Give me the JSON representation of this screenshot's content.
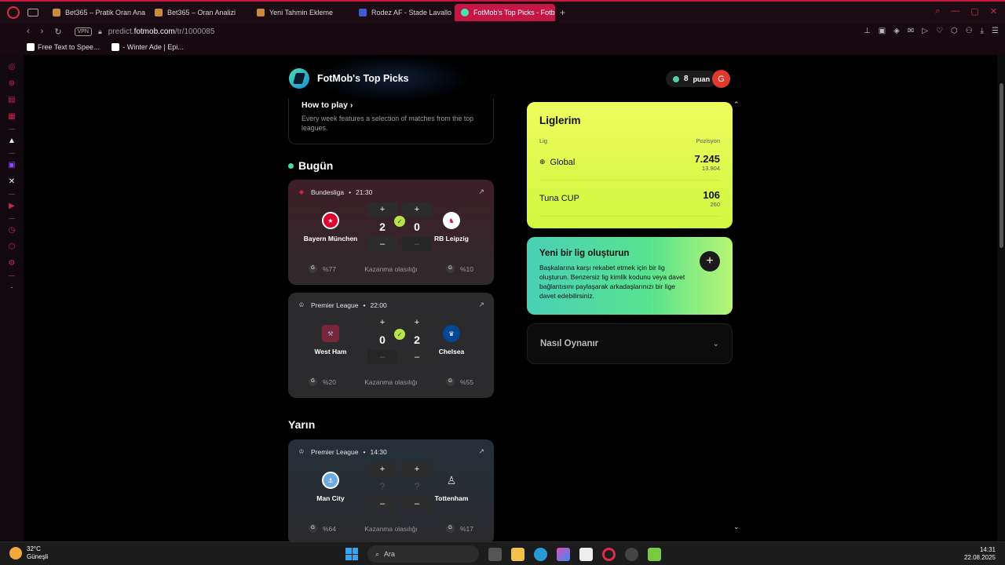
{
  "browser": {
    "tabs": [
      {
        "title": "Bet365 – Pratik Oran Ana",
        "color": "#c98b3a",
        "active": false
      },
      {
        "title": "Bet365 – Oran Analizi",
        "color": "#c98b3a",
        "active": false
      },
      {
        "title": "Yeni Tahmin Ekleme",
        "color": "#c98b3a",
        "active": false
      },
      {
        "title": "Rodez AF - Stade Lavallo",
        "color": "#3b5bd6",
        "active": false
      },
      {
        "title": "FotMob's Top Picks - Fotb",
        "color": "#49e0b4",
        "active": true
      }
    ],
    "new_tab": "+",
    "vpn": "VPN",
    "url_prefix": "predict.",
    "url_domain": "fotmob.com",
    "url_path": "/tr/1000085",
    "bookmarks": [
      "Free Text to Spee...",
      "- Winter Ade | Epi..."
    ]
  },
  "header": {
    "title": "FotMob's Top Picks",
    "points_value": "8",
    "points_unit": "puan",
    "avatar_letter": "G"
  },
  "howto": {
    "title": "How to play",
    "chevron": "›",
    "text": "Every week features a selection of matches from the top leagues."
  },
  "sections": {
    "today": "Bugün",
    "tomorrow": "Yarın"
  },
  "matches": [
    {
      "league": "Bundesliga",
      "time": "21:30",
      "home": "Bayern München",
      "away": "RB Leipzig",
      "home_score": "2",
      "away_score": "0",
      "home_pct": "%77",
      "away_pct": "%10",
      "win_label": "Kazanma olasılığı",
      "bg": "#3a1f26"
    },
    {
      "league": "Premier League",
      "time": "22:00",
      "home": "West Ham",
      "away": "Chelsea",
      "home_score": "0",
      "away_score": "2",
      "home_pct": "%20",
      "away_pct": "%55",
      "win_label": "Kazanma olasılığı",
      "bg": "#2a2b2e"
    },
    {
      "league": "Premier League",
      "time": "14:30",
      "home": "Man City",
      "away": "Tottenham",
      "home_score": "?",
      "away_score": "?",
      "home_pct": "%64",
      "away_pct": "%17",
      "win_label": "Kazanma olasılığı",
      "bg": "#23282e"
    }
  ],
  "leagues": {
    "title": "Liglerim",
    "col_league": "Lig",
    "col_position": "Pozisyon",
    "rows": [
      {
        "name": "Global",
        "position": "7.245",
        "total": "13.904"
      },
      {
        "name": "Tuna CUP",
        "position": "106",
        "total": "260"
      }
    ]
  },
  "create_league": {
    "title": "Yeni bir lig oluşturun",
    "text": "Başkalarına karşı rekabet etmek için bir lig oluşturun. Benzersiz lig kimlik kodunu veya davet bağlantısını paylaşarak arkadaşlarınızı bir lige davet edebilirsiniz.",
    "plus": "+"
  },
  "how_play": {
    "title": "Nasıl Oynanır"
  },
  "taskbar": {
    "temp": "32°C",
    "weather": "Güneşli",
    "search": "Ara",
    "time": "14:31",
    "date": "22.08.2025"
  }
}
